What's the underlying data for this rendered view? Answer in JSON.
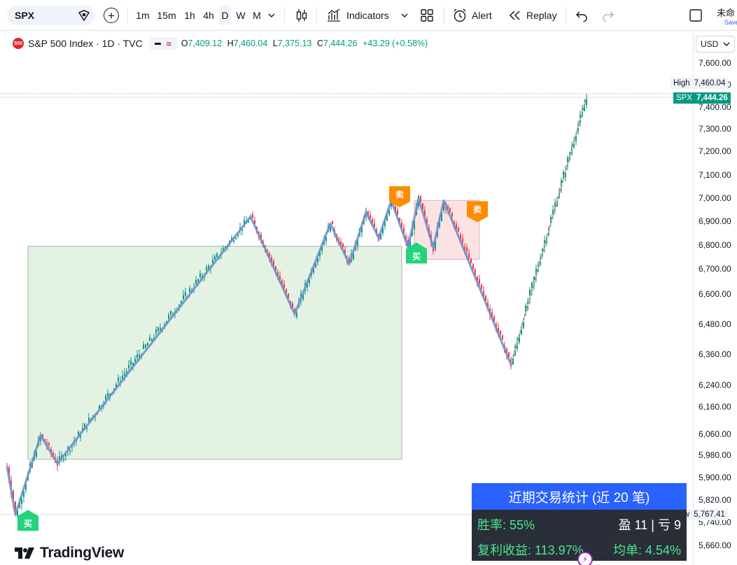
{
  "toolbar": {
    "symbol": "SPX",
    "timeframes": [
      "1m",
      "15m",
      "1h",
      "4h",
      "D",
      "W",
      "M"
    ],
    "active_timeframe": "D",
    "indicators_label": "Indicators",
    "alert_label": "Alert",
    "replay_label": "Replay",
    "layout_name": "未命",
    "save_label": "Save"
  },
  "legend": {
    "title": "S&P 500 Index · 1D · TVC",
    "logo_text": "500",
    "open_label": "O",
    "open": "7,409.12",
    "high_label": "H",
    "high": "7,460.04",
    "low_label": "L",
    "low": "7,375.13",
    "close_label": "C",
    "close": "7,444.26",
    "change": "+43.29 (+0.58%)"
  },
  "axis": {
    "currency": "USD",
    "high_label": "High",
    "high_value": "7,460.04",
    "last_symbol": "SPX",
    "last_value": "7,444.26",
    "low_label": "Low",
    "low_value": "5,767.41"
  },
  "chart_data": {
    "type": "candlestick",
    "y_ticks": [
      7600,
      7500,
      7400,
      7300,
      7200,
      7100,
      7000,
      6900,
      6800,
      6700,
      6600,
      6480,
      6360,
      6240,
      6160,
      6060,
      5980,
      5900,
      5820,
      5740,
      5660
    ],
    "y_tick_labels": [
      "7,600.00",
      "7,500.00",
      "7,400.00",
      "7,300.00",
      "7,200.00",
      "7,100.00",
      "7,000.00",
      "6,900.00",
      "6,800.00",
      "6,700.00",
      "6,600.00",
      "6,480.00",
      "6,360.00",
      "6,240.00",
      "6,160.00",
      "6,060.00",
      "5,980.00",
      "5,900.00",
      "5,820.00",
      "5,740.00",
      "5,660.00"
    ],
    "bars_count": 277,
    "last": 7444.26,
    "high": 7460.04,
    "low": 5767.41,
    "zigzag_pivots": [
      {
        "bar": 0,
        "price": 5940
      },
      {
        "bar": 4,
        "price": 5767
      },
      {
        "bar": 16,
        "price": 6055
      },
      {
        "bar": 24,
        "price": 5950
      },
      {
        "bar": 116,
        "price": 6920
      },
      {
        "bar": 137,
        "price": 6520
      },
      {
        "bar": 154,
        "price": 6890
      },
      {
        "bar": 163,
        "price": 6720
      },
      {
        "bar": 171,
        "price": 6940
      },
      {
        "bar": 177,
        "price": 6830
      },
      {
        "bar": 183,
        "price": 6990
      },
      {
        "bar": 191,
        "price": 6790
      },
      {
        "bar": 196,
        "price": 7000
      },
      {
        "bar": 203,
        "price": 6790
      },
      {
        "bar": 208,
        "price": 6990
      },
      {
        "bar": 240,
        "price": 6320
      }
    ],
    "projection": {
      "from_bar": 240,
      "from_price": 6320,
      "to_bar": 276,
      "to_price": 7444.26
    },
    "zones": [
      {
        "kind": "long",
        "from_bar": 10,
        "to_bar": 188,
        "top": 6795,
        "bottom": 5965
      },
      {
        "kind": "short",
        "from_bar": 194,
        "to_bar": 225,
        "top": 6990,
        "bottom": 6740
      }
    ],
    "signals": [
      {
        "type": "buy",
        "label": "买",
        "bar": 10,
        "price": 5767
      },
      {
        "type": "sell",
        "label": "卖",
        "bar": 187,
        "price": 6985
      },
      {
        "type": "buy",
        "label": "买",
        "bar": 195,
        "price": 6790
      },
      {
        "type": "sell",
        "label": "卖",
        "bar": 224,
        "price": 6920
      }
    ]
  },
  "stats": {
    "title": "近期交易统计 (近 20 笔)",
    "win_rate": "胜率: 55%",
    "win_loss": "盈 11 | 亏 9",
    "compound": "复利收益: 113.97%",
    "avg": "均单: 4.54%"
  },
  "branding": {
    "logo": "TradingView"
  },
  "colors": {
    "up": "#089981",
    "down": "#f23645",
    "zigzag": "#5b9bd5",
    "long_zone": "#e4f2e4",
    "short_zone": "#fbe3e4",
    "buy": "#22d37a",
    "sell": "#ff8c00"
  }
}
